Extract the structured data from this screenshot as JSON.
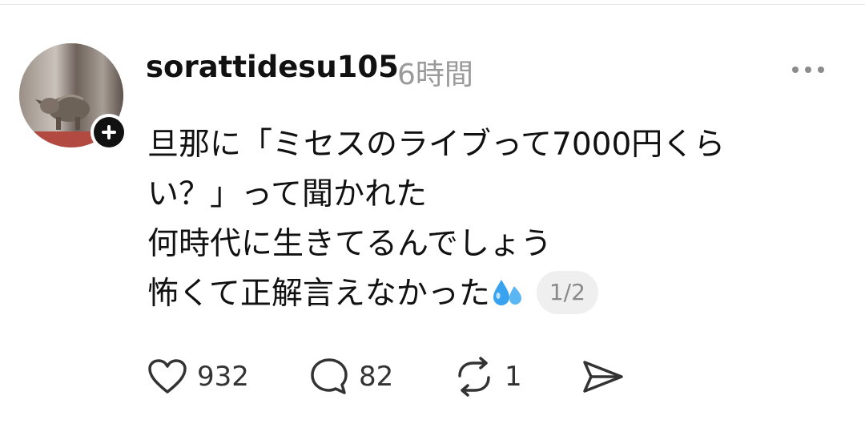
{
  "post": {
    "username": "sorattidesu105",
    "time": "6時間",
    "text_lines": [
      "旦那に「ミセスのライブって7000円くら",
      "い？」って聞かれた",
      "何時代に生きてるんでしょう",
      "怖くて正解言えなかった"
    ],
    "page_counter": "1/2",
    "emoji": "sweat-droplets-emoji"
  },
  "actions": {
    "likes": "932",
    "replies": "82",
    "reposts": "1"
  },
  "icons": {
    "like": "heart-icon",
    "reply": "comment-bubble-icon",
    "repost": "repost-icon",
    "share": "send-icon",
    "more": "more-dots-icon",
    "follow": "plus-icon"
  },
  "colors": {
    "text": "#111111",
    "muted": "#9a9a9a",
    "counter_bg": "#efefef",
    "emoji_blue": "#3aa3f0"
  }
}
